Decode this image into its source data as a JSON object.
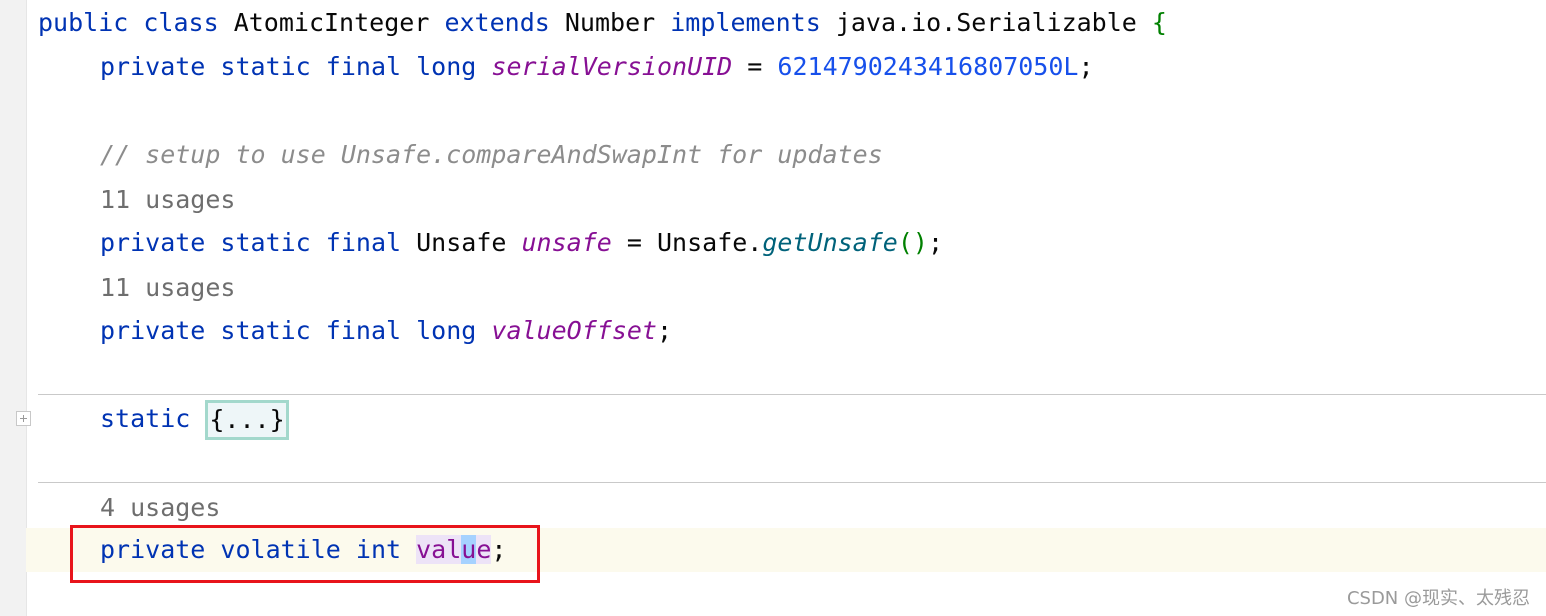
{
  "code": {
    "line1": {
      "kw1": "public",
      "kw2": "class",
      "name": "AtomicInteger",
      "kw3": "extends",
      "parent": "Number",
      "kw4": "implements",
      "iface": "java.io.Serializable",
      "brace": "{"
    },
    "line2": {
      "kw1": "private",
      "kw2": "static",
      "kw3": "final",
      "kw4": "long",
      "field": "serialVersionUID",
      "eq": "=",
      "num": "6214790243416807050L",
      "end": ";"
    },
    "comment": "// setup to use Unsafe.compareAndSwapInt for updates",
    "hint1": "11 usages",
    "line_unsafe": {
      "kw1": "private",
      "kw2": "static",
      "kw3": "final",
      "type": "Unsafe",
      "field": "unsafe",
      "eq": "=",
      "cls": "Unsafe.",
      "call": "getUnsafe",
      "parens": "()",
      "end": ";"
    },
    "hint2": "11 usages",
    "line_offset": {
      "kw1": "private",
      "kw2": "static",
      "kw3": "final",
      "kw4": "long",
      "field": "valueOffset",
      "end": ";"
    },
    "static_block": {
      "kw": "static",
      "folded": "{...}"
    },
    "hint3": "4 usages",
    "line_value": {
      "kw1": "private",
      "kw2": "volatile",
      "kw3": "int",
      "v1": "val",
      "v2": "u",
      "v3": "e",
      "end": ";"
    }
  },
  "watermark": "CSDN @现实、太残忍",
  "colors": {
    "keyword": "#0033b3",
    "field": "#871094",
    "number": "#1750eb",
    "method": "#00627a",
    "comment": "#8c8c8c",
    "highlight_box": "#e8141b"
  }
}
